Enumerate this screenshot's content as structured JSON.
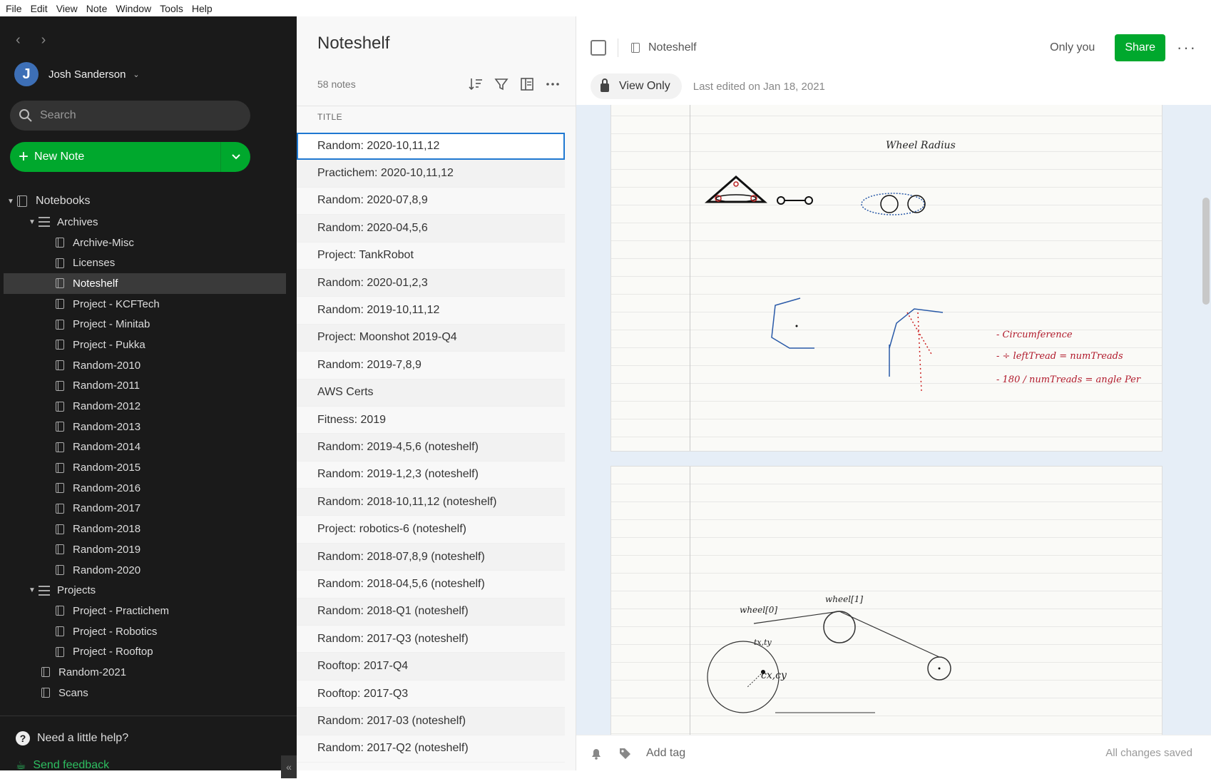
{
  "menu": [
    "File",
    "Edit",
    "View",
    "Note",
    "Window",
    "Tools",
    "Help"
  ],
  "sidebar": {
    "user": {
      "initial": "J",
      "name": "Josh Sanderson"
    },
    "search_placeholder": "Search",
    "new_note_label": "New Note",
    "notebooks_label": "Notebooks",
    "tree": [
      {
        "label": "Archives",
        "type": "stack",
        "level": 1,
        "expanded": true
      },
      {
        "label": "Archive-Misc",
        "type": "notebook",
        "level": 2
      },
      {
        "label": "Licenses",
        "type": "notebook",
        "level": 2
      },
      {
        "label": "Noteshelf",
        "type": "notebook",
        "level": 2,
        "selected": true
      },
      {
        "label": "Project - KCFTech",
        "type": "notebook",
        "level": 2
      },
      {
        "label": "Project - Minitab",
        "type": "notebook",
        "level": 2
      },
      {
        "label": "Project - Pukka",
        "type": "notebook",
        "level": 2
      },
      {
        "label": "Random-2010",
        "type": "notebook",
        "level": 2
      },
      {
        "label": "Random-2011",
        "type": "notebook",
        "level": 2
      },
      {
        "label": "Random-2012",
        "type": "notebook",
        "level": 2
      },
      {
        "label": "Random-2013",
        "type": "notebook",
        "level": 2
      },
      {
        "label": "Random-2014",
        "type": "notebook",
        "level": 2
      },
      {
        "label": "Random-2015",
        "type": "notebook",
        "level": 2
      },
      {
        "label": "Random-2016",
        "type": "notebook",
        "level": 2
      },
      {
        "label": "Random-2017",
        "type": "notebook",
        "level": 2
      },
      {
        "label": "Random-2018",
        "type": "notebook",
        "level": 2
      },
      {
        "label": "Random-2019",
        "type": "notebook",
        "level": 2
      },
      {
        "label": "Random-2020",
        "type": "notebook",
        "level": 2
      },
      {
        "label": "Projects",
        "type": "stack",
        "level": 1,
        "expanded": true
      },
      {
        "label": "Project - Practichem",
        "type": "notebook",
        "level": 2
      },
      {
        "label": "Project - Robotics",
        "type": "notebook",
        "level": 2
      },
      {
        "label": "Project - Rooftop",
        "type": "notebook",
        "level": 2
      },
      {
        "label": "Random-2021",
        "type": "notebook",
        "level": 1
      },
      {
        "label": "Scans",
        "type": "notebook",
        "level": 1
      }
    ],
    "help_label": "Need a little help?",
    "feedback_label": "Send feedback"
  },
  "notelist": {
    "title": "Noteshelf",
    "count": "58 notes",
    "column_header": "TITLE",
    "notes": [
      "Random: 2020-10,11,12",
      "Practichem: 2020-10,11,12",
      "Random: 2020-07,8,9",
      "Random: 2020-04,5,6",
      "Project: TankRobot",
      "Random: 2020-01,2,3",
      "Random: 2019-10,11,12",
      "Project: Moonshot 2019-Q4",
      "Random: 2019-7,8,9",
      "AWS Certs",
      "Fitness: 2019",
      "Random: 2019-4,5,6 (noteshelf)",
      "Random: 2019-1,2,3 (noteshelf)",
      "Random: 2018-10,11,12 (noteshelf)",
      "Project: robotics-6 (noteshelf)",
      "Random: 2018-07,8,9 (noteshelf)",
      "Random: 2018-04,5,6 (noteshelf)",
      "Random: 2018-Q1 (noteshelf)",
      "Random: 2017-Q3 (noteshelf)",
      "Rooftop: 2017-Q4",
      "Rooftop: 2017-Q3",
      "Random: 2017-03 (noteshelf)",
      "Random: 2017-Q2 (noteshelf)"
    ]
  },
  "editor": {
    "notebook": "Noteshelf",
    "sharing": "Only you",
    "share_label": "Share",
    "view_only_label": "View Only",
    "last_edited": "Last edited on Jan 18, 2021",
    "add_tag_label": "Add tag",
    "status": "All changes saved",
    "sketch_text": {
      "title": "Wheel Radius",
      "note1": "- Circumference",
      "note2": "- ÷ leftTread = numTreads",
      "note3": "- 180 / numTreads = angle Per",
      "wheel0": "wheel[0]",
      "wheel1": "wheel[1]",
      "txy": "tx,ty",
      "cxcy": "cx,cy"
    }
  }
}
